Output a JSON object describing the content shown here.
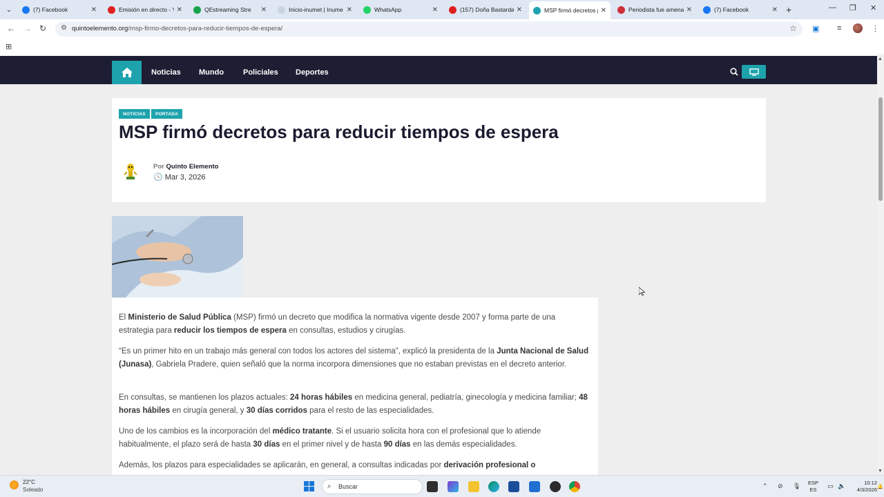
{
  "browser": {
    "tabs": [
      {
        "title": "(7) Facebook",
        "color": "#1877f2",
        "active": false
      },
      {
        "title": "Emisión en directo - Y",
        "color": "#e02020",
        "active": false
      },
      {
        "title": "QEstreaming Stre",
        "color": "#1aa34a",
        "active": false
      },
      {
        "title": "Inicio-inumet | Inume",
        "color": "#c9d4e2",
        "active": false
      },
      {
        "title": "WhatsApp",
        "color": "#25d366",
        "active": false
      },
      {
        "title": "(157) Doña Bastarda",
        "color": "#e02020",
        "active": false
      },
      {
        "title": "MSP firmó decretos p",
        "color": "#1ea3ad",
        "active": true
      },
      {
        "title": "Periodista fue amena",
        "color": "#d0303a",
        "active": false
      },
      {
        "title": "(7) Facebook",
        "color": "#1877f2",
        "active": false
      }
    ],
    "url_domain": "quintoelemento.org",
    "url_path": "/msp-firmo-decretos-para-reducir-tiempos-de-espera/"
  },
  "nav": {
    "items": [
      "Noticias",
      "Mundo",
      "Policiales",
      "Deportes"
    ]
  },
  "article": {
    "categories": [
      "NOTICIAS",
      "PORTADA"
    ],
    "title": "MSP firmó decretos para reducir tiempos de espera",
    "by_prefix": "Por",
    "author": "Quinto Elemento",
    "date": "Mar 3, 2026",
    "paragraphs": [
      [
        {
          "t": "El ",
          "b": false
        },
        {
          "t": "Ministerio de Salud Pública",
          "b": true
        },
        {
          "t": " (MSP) firmó un decreto que modifica la normativa vigente desde 2007 y forma parte de una estrategia para ",
          "b": false
        },
        {
          "t": "reducir los tiempos de espera",
          "b": true
        },
        {
          "t": " en consultas, estudios y cirugías.",
          "b": false
        }
      ],
      [
        {
          "t": "“Es un primer hito en un trabajo más general con todos los actores del sistema”, explicó la presidenta de la ",
          "b": false
        },
        {
          "t": "Junta Nacional de Salud (Junasa)",
          "b": true
        },
        {
          "t": ", Gabriela Pradere, quien señaló que la norma incorpora dimensiones que no estaban previstas en el decreto anterior.",
          "b": false
        }
      ],
      [
        {
          "t": "En consultas, se mantienen los plazos actuales: ",
          "b": false
        },
        {
          "t": "24 horas hábiles",
          "b": true
        },
        {
          "t": " en medicina general, pediatría, ginecología y medicina familiar; ",
          "b": false
        },
        {
          "t": "48 horas hábiles",
          "b": true
        },
        {
          "t": " en cirugía general, y ",
          "b": false
        },
        {
          "t": "30 días corridos",
          "b": true
        },
        {
          "t": " para el resto de las especialidades.",
          "b": false
        }
      ],
      [
        {
          "t": "Uno de los cambios es la incorporación del ",
          "b": false
        },
        {
          "t": "médico tratante",
          "b": true
        },
        {
          "t": ". Si el usuario solicita hora con el profesional que lo atiende habitualmente, el plazo será de hasta ",
          "b": false
        },
        {
          "t": "30 días",
          "b": true
        },
        {
          "t": " en el primer nivel y de hasta ",
          "b": false
        },
        {
          "t": "90 días",
          "b": true
        },
        {
          "t": " en las demás especialidades.",
          "b": false
        }
      ],
      [
        {
          "t": "Además, los plazos para especialidades se aplicarán, en general, a consultas indicadas por ",
          "b": false
        },
        {
          "t": "derivación profesional o",
          "b": true
        }
      ]
    ]
  },
  "taskbar": {
    "temp": "22°C",
    "weather": "Soleado",
    "search_label": "Buscar",
    "lang_top": "ESP",
    "lang_bottom": "ES",
    "time": "10:12",
    "date": "4/3/2026"
  },
  "colors": {
    "accent": "#1ea3ad",
    "navbar": "#1d1d33"
  }
}
